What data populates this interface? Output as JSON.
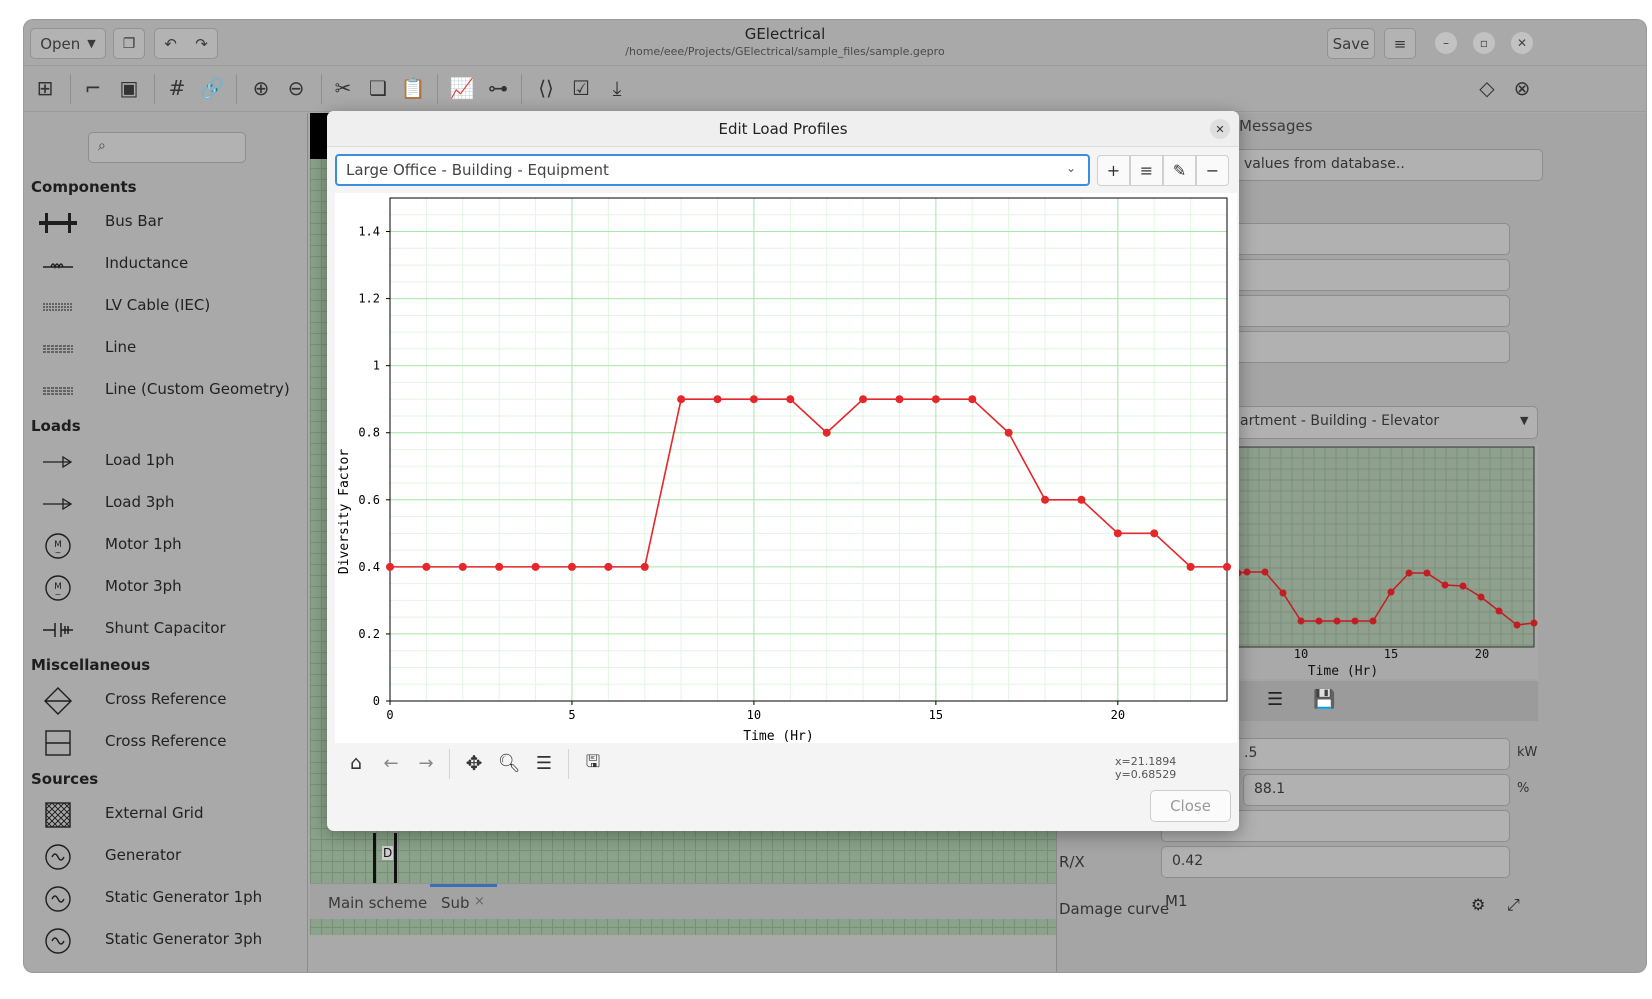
{
  "window": {
    "title": "GElectrical",
    "path": "/home/eee/Projects/GElectrical/sample_files/sample.gepro",
    "open_label": "Open",
    "save_label": "Save"
  },
  "sidebar": {
    "search_placeholder": "",
    "sections": [
      {
        "title": "Components"
      },
      {
        "title": "Loads"
      },
      {
        "title": "Miscellaneous"
      },
      {
        "title": "Sources"
      }
    ],
    "items": [
      {
        "label": "Bus Bar",
        "icon": "busbar-icon"
      },
      {
        "label": "Inductance",
        "icon": "inductance-icon"
      },
      {
        "label": "LV Cable (IEC)",
        "icon": "cable-icon"
      },
      {
        "label": "Line",
        "icon": "line-icon"
      },
      {
        "label": "Line (Custom Geometry)",
        "icon": "line-custom-icon"
      },
      {
        "label": "Load 1ph",
        "icon": "load-1ph-icon"
      },
      {
        "label": "Load 3ph",
        "icon": "load-3ph-icon"
      },
      {
        "label": "Motor 1ph",
        "icon": "motor-1ph-icon"
      },
      {
        "label": "Motor 3ph",
        "icon": "motor-3ph-icon"
      },
      {
        "label": "Shunt Capacitor",
        "icon": "capacitor-icon"
      },
      {
        "label": "Cross Reference",
        "icon": "cross-reference-diamond-icon"
      },
      {
        "label": "Cross Reference",
        "icon": "cross-reference-box-icon"
      },
      {
        "label": "External Grid",
        "icon": "external-grid-icon"
      },
      {
        "label": "Generator",
        "icon": "generator-icon"
      },
      {
        "label": "Static Generator 1ph",
        "icon": "static-generator-icon"
      },
      {
        "label": "Static Generator 3ph",
        "icon": "static-generator-icon"
      }
    ]
  },
  "canvas": {
    "element_label": "D",
    "tabs": [
      {
        "label": "Main scheme"
      },
      {
        "label": "Sub"
      }
    ]
  },
  "right_panel": {
    "tab_label": "Messages",
    "db_field": "values from database..",
    "profile_combo": "artment - Building - Elevator",
    "mini_xticks": [
      "10",
      "15",
      "20"
    ],
    "mini_xlabel": "Time (Hr)",
    "field_value_1": ".5",
    "field_unit_1": "kW",
    "field_value_2": "88.1",
    "field_unit_2": "%",
    "rx_label": "R/X",
    "rx_value": "0.42",
    "damage_label": "Damage curve",
    "damage_value": "M1"
  },
  "dialog": {
    "title": "Edit Load Profiles",
    "profile": "Large Office - Building - Equipment",
    "coords": "x=21.1894 y=0.68529",
    "close_label": "Close"
  },
  "chart_data": {
    "type": "line",
    "xlabel": "Time (Hr)",
    "ylabel": "Diversity Factor",
    "xlim": [
      0,
      23
    ],
    "ylim": [
      0,
      1.5
    ],
    "xticks": [
      0,
      5,
      10,
      15,
      20
    ],
    "yticks": [
      0,
      0.2,
      0.4,
      0.6,
      0.8,
      1,
      1.2,
      1.4
    ],
    "color": "#e5262b",
    "grid": true,
    "x": [
      0,
      1,
      2,
      3,
      4,
      5,
      6,
      7,
      8,
      9,
      10,
      11,
      12,
      13,
      14,
      15,
      16,
      17,
      18,
      19,
      20,
      21,
      22,
      23
    ],
    "y": [
      0.4,
      0.4,
      0.4,
      0.4,
      0.4,
      0.4,
      0.4,
      0.4,
      0.9,
      0.9,
      0.9,
      0.9,
      0.8,
      0.9,
      0.9,
      0.9,
      0.9,
      0.8,
      0.6,
      0.6,
      0.5,
      0.5,
      0.4,
      0.4
    ]
  }
}
